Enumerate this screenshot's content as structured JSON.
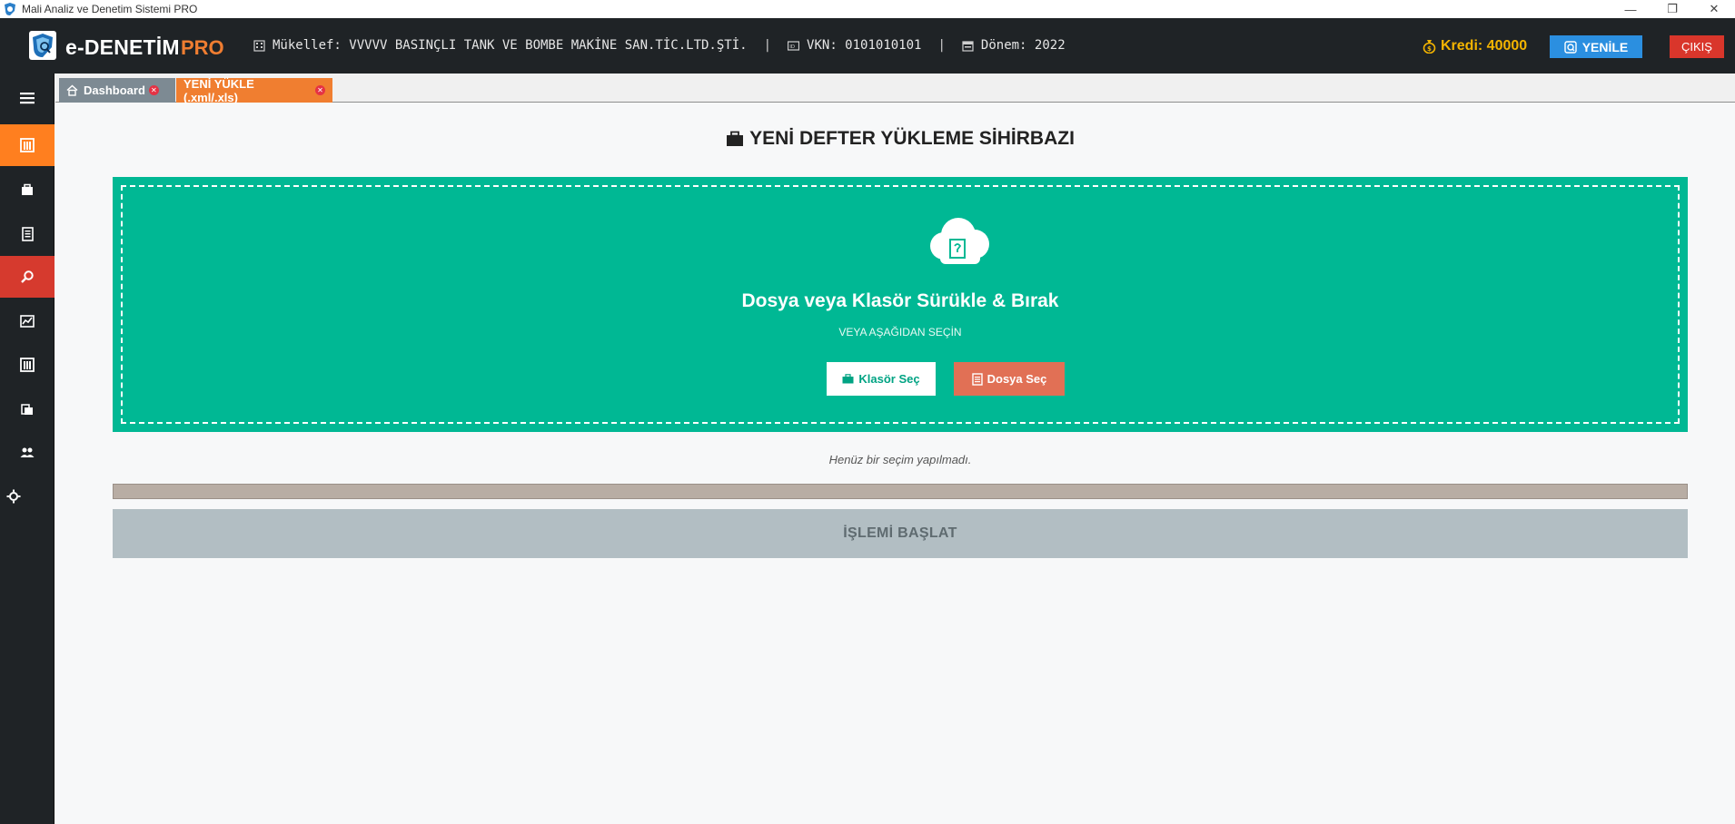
{
  "window": {
    "title": "Mali Analiz ve Denetim Sistemi PRO",
    "controls": [
      "—",
      "❐",
      "✕"
    ]
  },
  "header": {
    "brand": "e-DENETİM",
    "brand_suffix": "PRO",
    "taxpayer": "Mükellef: VVVVV BASINÇLI TANK VE BOMBE MAKİNE SAN.TİC.LTD.ŞTİ.",
    "vkn": "VKN: 0101010101",
    "period": "Dönem: 2022",
    "separator": "|",
    "credit": "Kredi: 40000",
    "refresh_label": "YENİLE",
    "exit_label": "ÇIKIŞ"
  },
  "sidebar": {
    "items": [
      {
        "icon": "menu-icon"
      },
      {
        "icon": "building-icon",
        "active": true
      },
      {
        "icon": "briefcase-icon"
      },
      {
        "icon": "document-icon"
      },
      {
        "icon": "search-icon",
        "highlight": true
      },
      {
        "icon": "chart-icon"
      },
      {
        "icon": "building-icon"
      },
      {
        "icon": "folder-icon"
      },
      {
        "icon": "users-icon"
      },
      {
        "icon": "gear-icon"
      }
    ]
  },
  "tabs": [
    {
      "label": "Dashboard",
      "icon": "home-icon"
    },
    {
      "label": "YENİ YÜKLE (.xml/.xls)",
      "active": true
    }
  ],
  "main": {
    "title": "YENİ DEFTER YÜKLEME SİHİRBAZI",
    "dropzone": {
      "title": "Dosya veya Klasör Sürükle & Bırak",
      "subtitle": "VEYA AŞAĞIDAN SEÇİN",
      "folder_button": "Klasör Seç",
      "file_button": "Dosya Seç"
    },
    "selection_status": "Henüz bir seçim yapılmadı.",
    "progress": 0,
    "start_button": "İŞLEMİ BAŞLAT"
  },
  "colors": {
    "accent_green": "#00b894",
    "accent_orange": "#ef7d31",
    "accent_red": "#d63a2e",
    "accent_blue": "#2b8fe0",
    "credit_gold": "#f4b400"
  }
}
